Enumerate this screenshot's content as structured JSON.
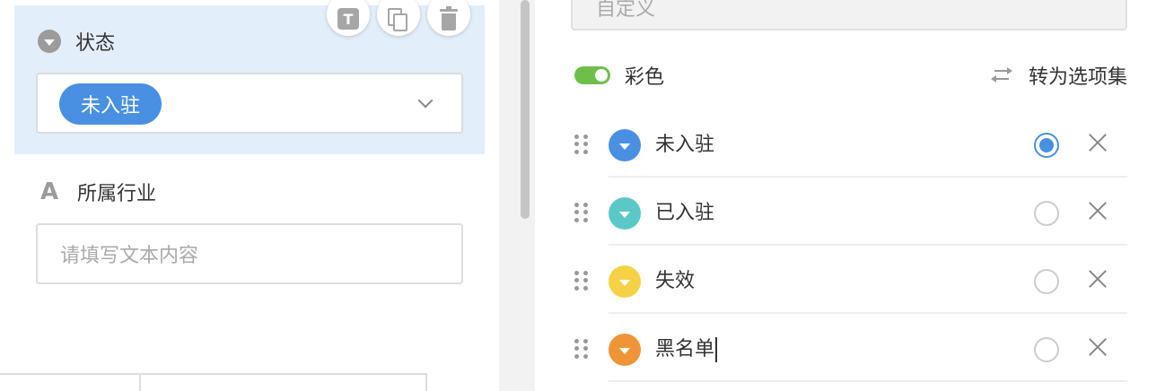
{
  "left_form": {
    "status_field": {
      "title": "状态",
      "selected_tag": "未入驻",
      "tag_color": "#4a90e2",
      "toolbar": [
        "text-tool-icon",
        "copy-icon",
        "trash-icon"
      ]
    },
    "industry_field": {
      "title": "所属行业",
      "placeholder": "请填写文本内容"
    }
  },
  "right_panel": {
    "custom_select_value": "自定义",
    "color_label": "彩色",
    "color_enabled": true,
    "toggle_color": "#6cc04a",
    "convert_label": "转为选项集",
    "options": [
      {
        "label": "未入驻",
        "color": "#4a90e2",
        "default": true
      },
      {
        "label": "已入驻",
        "color": "#5bc8c8",
        "default": false
      },
      {
        "label": "失效",
        "color": "#f5d245",
        "default": false
      },
      {
        "label": "黑名单",
        "color": "#f09537",
        "default": false
      }
    ]
  }
}
